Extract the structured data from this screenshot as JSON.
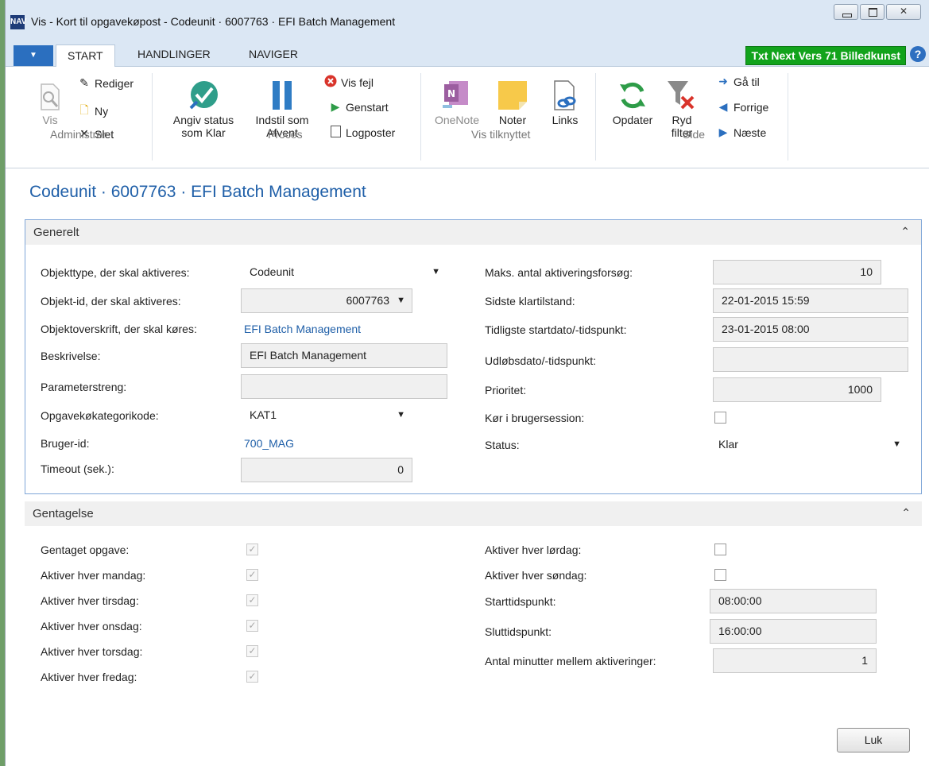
{
  "window": {
    "title": "Vis - Kort til opgavekøpost - Codeunit · 6007763 · EFI Batch Management",
    "logo_text": "NAV"
  },
  "tabs": [
    {
      "label": "START"
    },
    {
      "label": "HANDLINGER"
    },
    {
      "label": "NAVIGER"
    }
  ],
  "badge": {
    "text": "Txt Next Vers 71 Billedkunst",
    "color": "#12a31c"
  },
  "ribbon": {
    "administrer": {
      "label": "Administrer",
      "vis": "Vis",
      "rediger": "Rediger",
      "ny": "Ny",
      "slet": "Slet"
    },
    "proces": {
      "label": "Proces",
      "angiv_line1": "Angiv status",
      "angiv_line2": "som Klar",
      "indstil_line1": "Indstil som",
      "indstil_line2": "Afvent",
      "vis_fejl": "Vis fejl",
      "genstart": "Genstart",
      "logposter": "Logposter"
    },
    "vis_tilknyttet": {
      "label": "Vis tilknyttet",
      "onenote": "OneNote",
      "noter": "Noter",
      "links": "Links"
    },
    "side": {
      "label": "Side",
      "opdater": "Opdater",
      "ryd_line1": "Ryd",
      "ryd_line2": "filter",
      "gaa_til": "Gå til",
      "forrige": "Forrige",
      "naeste": "Næste"
    }
  },
  "page_title": "Codeunit · 6007763 · EFI Batch Management",
  "generelt": {
    "title": "Generelt",
    "left": {
      "objekttype": {
        "label": "Objekttype, der skal aktiveres:",
        "value": "Codeunit"
      },
      "objekt_id": {
        "label": "Objekt-id, der skal aktiveres:",
        "value": "6007763"
      },
      "objektoverskrift": {
        "label": "Objektoverskrift, der skal køres:",
        "value": "EFI Batch Management"
      },
      "beskrivelse": {
        "label": "Beskrivelse:",
        "value": "EFI Batch Management"
      },
      "parameterstreng": {
        "label": "Parameterstreng:",
        "value": ""
      },
      "kategorikode": {
        "label": "Opgavekøkategorikode:",
        "value": "KAT1"
      },
      "bruger_id": {
        "label": "Bruger-id:",
        "value": "700_MAG"
      },
      "timeout": {
        "label": "Timeout (sek.):",
        "value": "0"
      }
    },
    "right": {
      "maks": {
        "label": "Maks. antal aktiveringsforsøg:",
        "value": "10"
      },
      "sidste": {
        "label": "Sidste klartilstand:",
        "value": "22-01-2015 15:59"
      },
      "tidligste": {
        "label": "Tidligste startdato/-tidspunkt:",
        "value": "23-01-2015 08:00"
      },
      "udloeb": {
        "label": "Udløbsdato/-tidspunkt:",
        "value": ""
      },
      "prioritet": {
        "label": "Prioritet:",
        "value": "1000"
      },
      "koer": {
        "label": "Kør i brugersession:",
        "checked": false
      },
      "status": {
        "label": "Status:",
        "value": "Klar"
      }
    }
  },
  "gentagelse": {
    "title": "Gentagelse",
    "left": [
      {
        "label": "Gentaget opgave:",
        "checked": true
      },
      {
        "label": "Aktiver hver mandag:",
        "checked": true
      },
      {
        "label": "Aktiver hver tirsdag:",
        "checked": true
      },
      {
        "label": "Aktiver hver onsdag:",
        "checked": true
      },
      {
        "label": "Aktiver hver torsdag:",
        "checked": true
      },
      {
        "label": "Aktiver hver fredag:",
        "checked": true
      }
    ],
    "right": {
      "loerdag": {
        "label": "Aktiver hver lørdag:",
        "checked": false
      },
      "soendag": {
        "label": "Aktiver hver søndag:",
        "checked": false
      },
      "start": {
        "label": "Starttidspunkt:",
        "value": "08:00:00"
      },
      "slut": {
        "label": "Sluttidspunkt:",
        "value": "16:00:00"
      },
      "antal": {
        "label": "Antal minutter mellem aktiveringer:",
        "value": "1"
      }
    }
  },
  "buttons": {
    "luk": "Luk"
  }
}
